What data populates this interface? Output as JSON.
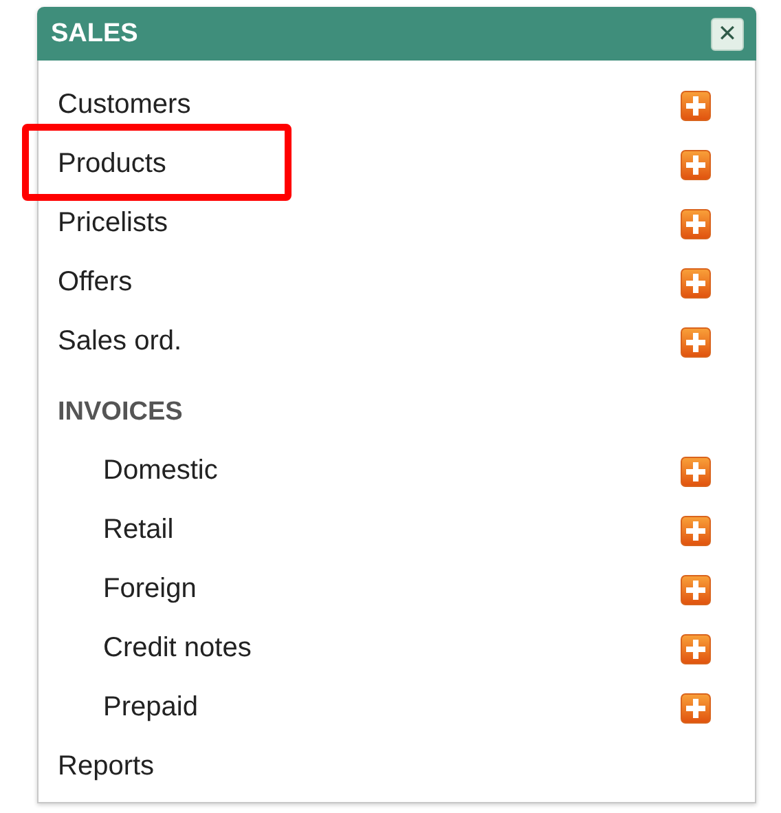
{
  "panel": {
    "title": "SALES",
    "close_label": "✕"
  },
  "items": [
    {
      "kind": "link",
      "label": "Customers",
      "add": true,
      "highlighted": false
    },
    {
      "kind": "link",
      "label": "Products",
      "add": true,
      "highlighted": true
    },
    {
      "kind": "link",
      "label": "Pricelists",
      "add": true,
      "highlighted": false
    },
    {
      "kind": "link",
      "label": "Offers",
      "add": true,
      "highlighted": false
    },
    {
      "kind": "link",
      "label": "Sales ord.",
      "add": true,
      "highlighted": false
    },
    {
      "kind": "section",
      "label": "INVOICES",
      "children": [
        {
          "kind": "link",
          "label": "Domestic",
          "add": true,
          "highlighted": false
        },
        {
          "kind": "link",
          "label": "Retail",
          "add": true,
          "highlighted": false
        },
        {
          "kind": "link",
          "label": "Foreign",
          "add": true,
          "highlighted": false
        },
        {
          "kind": "link",
          "label": "Credit notes",
          "add": true,
          "highlighted": false
        },
        {
          "kind": "link",
          "label": "Prepaid",
          "add": true,
          "highlighted": false
        }
      ]
    },
    {
      "kind": "link",
      "label": "Reports",
      "add": false,
      "highlighted": false
    }
  ]
}
